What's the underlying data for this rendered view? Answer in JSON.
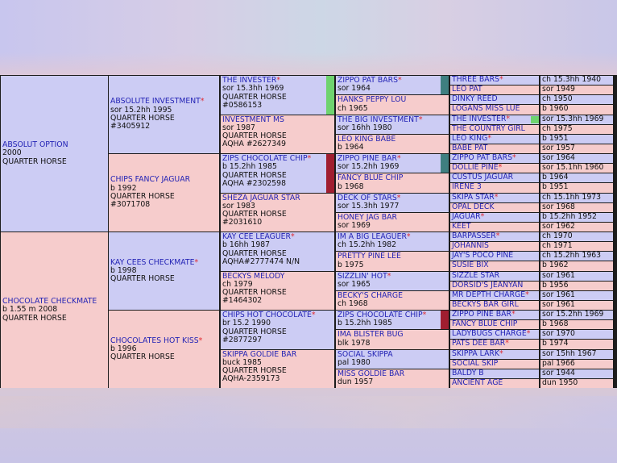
{
  "colors": {
    "sire_bg": "#ccccf4",
    "dam_bg": "#f6cccc",
    "name": "#2323b5",
    "star": "#e0262c"
  },
  "star": "*",
  "g1": [
    {
      "name": "ABSOLUT OPTION",
      "l1": "2000",
      "l2": "QUARTER HORSE"
    },
    {
      "name": "CHOCOLATE CHECKMATE",
      "l1": "b 1.55 m 2008",
      "l2": "QUARTER HORSE"
    }
  ],
  "g2": [
    {
      "name": "ABSOLUTE INVESTMENT",
      "star": true,
      "l1": "sor 15.2hh 1995",
      "l2": "QUARTER HORSE",
      "l3": "#3405912"
    },
    {
      "name": "CHIPS FANCY JAGUAR",
      "l1": "b 1992",
      "l2": "QUARTER HORSE",
      "l3": "#3071708"
    },
    {
      "name": "KAY CEES CHECKMATE",
      "star": true,
      "l1": "b 1998",
      "l2": "QUARTER HORSE"
    },
    {
      "name": "CHOCOLATES HOT KISS",
      "star": true,
      "l1": "b 1996",
      "l2": "QUARTER HORSE"
    }
  ],
  "g3": [
    {
      "name": "THE INVESTER",
      "star": true,
      "l1": "sor 15.3hh 1969",
      "l2": "QUARTER HORSE",
      "l3": "#0586153"
    },
    {
      "name": "INVESTMENT MS",
      "l1": "sor 1987",
      "l2": "QUARTER HORSE",
      "l3": "AQHA #2627349"
    },
    {
      "name": "ZIPS CHOCOLATE CHIP",
      "star": true,
      "l1": "b 15.2hh 1985",
      "l2": "QUARTER HORSE",
      "l3": "AQHA #2302598"
    },
    {
      "name": "SHEZA JAGUAR STAR",
      "l1": "sor 1983",
      "l2": "QUARTER HORSE",
      "l3": "#2031610"
    },
    {
      "name": "KAY CEE LEAGUER",
      "star": true,
      "l1": "b 16hh 1987",
      "l2": "QUARTER HORSE",
      "l3": "AQHA#2777474 N/N"
    },
    {
      "name": "BECKYS MELODY",
      "l1": "ch 1979",
      "l2": "QUARTER HORSE",
      "l3": "#1464302"
    },
    {
      "name": "CHIPS HOT CHOCOLATE",
      "star": true,
      "l1": "br 15.2 1990",
      "l2": "QUARTER HORSE",
      "l3": "#2877297"
    },
    {
      "name": "SKIPPA GOLDIE BAR",
      "l1": "buck 1985",
      "l2": "QUARTER HORSE",
      "l3": "AQHA-2359173"
    }
  ],
  "g4": [
    {
      "name": "ZIPPO PAT BARS",
      "star": true,
      "l1": "sor 1964"
    },
    {
      "name": "HANKS PEPPY LOU",
      "l1": "ch 1965"
    },
    {
      "name": "THE BIG INVESTMENT",
      "star": true,
      "l1": "sor 16hh 1980"
    },
    {
      "name": "LEO KING BABE",
      "l1": "b 1964"
    },
    {
      "name": "ZIPPO PINE BAR",
      "star": true,
      "l1": "sor 15.2hh 1969"
    },
    {
      "name": "FANCY BLUE CHIP",
      "l1": "b 1968"
    },
    {
      "name": "DECK OF STARS",
      "star": true,
      "l1": "sor 15.3hh 1977"
    },
    {
      "name": "HONEY JAG BAR",
      "l1": "sor 1969"
    },
    {
      "name": "IM A BIG LEAGUER",
      "star": true,
      "l1": "ch 15.2hh 1982"
    },
    {
      "name": "PRETTY PINE LEE",
      "l1": "b 1975"
    },
    {
      "name": "SIZZLIN' HOT",
      "star": true,
      "l1": "sor 1965"
    },
    {
      "name": "BECKY'S CHARGE",
      "l1": "ch 1968"
    },
    {
      "name": "ZIPS CHOCOLATE CHIP",
      "star": true,
      "l1": "b 15.2hh 1985"
    },
    {
      "name": "IMA BLISTER BUG",
      "l1": "blk 1978"
    },
    {
      "name": "SOCIAL SKIPPA",
      "l1": "pal 1980"
    },
    {
      "name": "MISS GOLDIE BAR",
      "l1": "dun 1957"
    }
  ],
  "g5": [
    {
      "name": "THREE BARS",
      "star": true,
      "info": "ch 15.3hh 1940"
    },
    {
      "name": "LEO PAT",
      "info": "sor 1949"
    },
    {
      "name": "DINKY REED",
      "info": "ch 1950"
    },
    {
      "name": "LOGANS MISS LUE",
      "info": "b 1960"
    },
    {
      "name": "THE INVESTER",
      "star": true,
      "info": "sor 15.3hh 1969"
    },
    {
      "name": "THE COUNTRY GIRL",
      "info": "ch 1975"
    },
    {
      "name": "LEO KING",
      "star": true,
      "info": "b 1951"
    },
    {
      "name": "BABE PAT",
      "info": "sor 1957"
    },
    {
      "name": "ZIPPO PAT BARS",
      "star": true,
      "info": "sor 1964"
    },
    {
      "name": "DOLLIE PINE",
      "star": true,
      "info": "sor 15.1hh 1960"
    },
    {
      "name": "CUSTUS JAGUAR",
      "info": "b 1964"
    },
    {
      "name": "IRENE 3",
      "info": "b 1951"
    },
    {
      "name": "SKIPA STAR",
      "star": true,
      "info": "ch 15.1hh 1973"
    },
    {
      "name": "OPAL DECK",
      "info": "sor 1968"
    },
    {
      "name": "JAGUAR",
      "star": true,
      "info": "b 15.2hh 1952"
    },
    {
      "name": "KEET",
      "info": "sor 1962"
    },
    {
      "name": "BARPASSER",
      "star": true,
      "info": "ch 1970"
    },
    {
      "name": "JOHANNIS",
      "info": "ch 1971"
    },
    {
      "name": "JAY'S POCO PINE",
      "info": "ch 15.2hh 1963"
    },
    {
      "name": "SUSIE BIX",
      "info": "b 1962"
    },
    {
      "name": "SIZZLE STAR",
      "info": "sor 1961"
    },
    {
      "name": "DORSID'S JEANYAN",
      "info": "b 1956"
    },
    {
      "name": "MR DEPTH CHARGE",
      "star": true,
      "info": "sor 1961"
    },
    {
      "name": "BECKYS BAR GIRL",
      "info": "sor 1961"
    },
    {
      "name": "ZIPPO PINE BAR",
      "star": true,
      "info": "sor 15.2hh 1969"
    },
    {
      "name": "FANCY BLUE CHIP",
      "info": "b 1968"
    },
    {
      "name": "LADYBUGS CHARGE",
      "star": true,
      "info": "sor 1970"
    },
    {
      "name": "PATS DEE BAR",
      "star": true,
      "info": "b 1974"
    },
    {
      "name": "SKIPPA LARK",
      "star": true,
      "info": "sor 15hh 1967"
    },
    {
      "name": "SOCIAL SKIP",
      "info": "pal 1966"
    },
    {
      "name": "BALDY B",
      "info": "sor 1944"
    },
    {
      "name": "ANCIENT AGE",
      "info": "dun 1950"
    }
  ],
  "swatches": [
    {
      "gen": 4,
      "row": 0,
      "color": "#3f7f80"
    },
    {
      "gen": 4,
      "row": 4,
      "color": "#3f7f80"
    },
    {
      "gen": 5,
      "row": 4,
      "color": "#6fd36f"
    },
    {
      "gen": 3,
      "row": 0,
      "color": "#6fd36f"
    },
    {
      "gen": 3,
      "row": 2,
      "color": "#a01e30"
    },
    {
      "gen": 4,
      "row": 12,
      "color": "#a01e30"
    }
  ]
}
